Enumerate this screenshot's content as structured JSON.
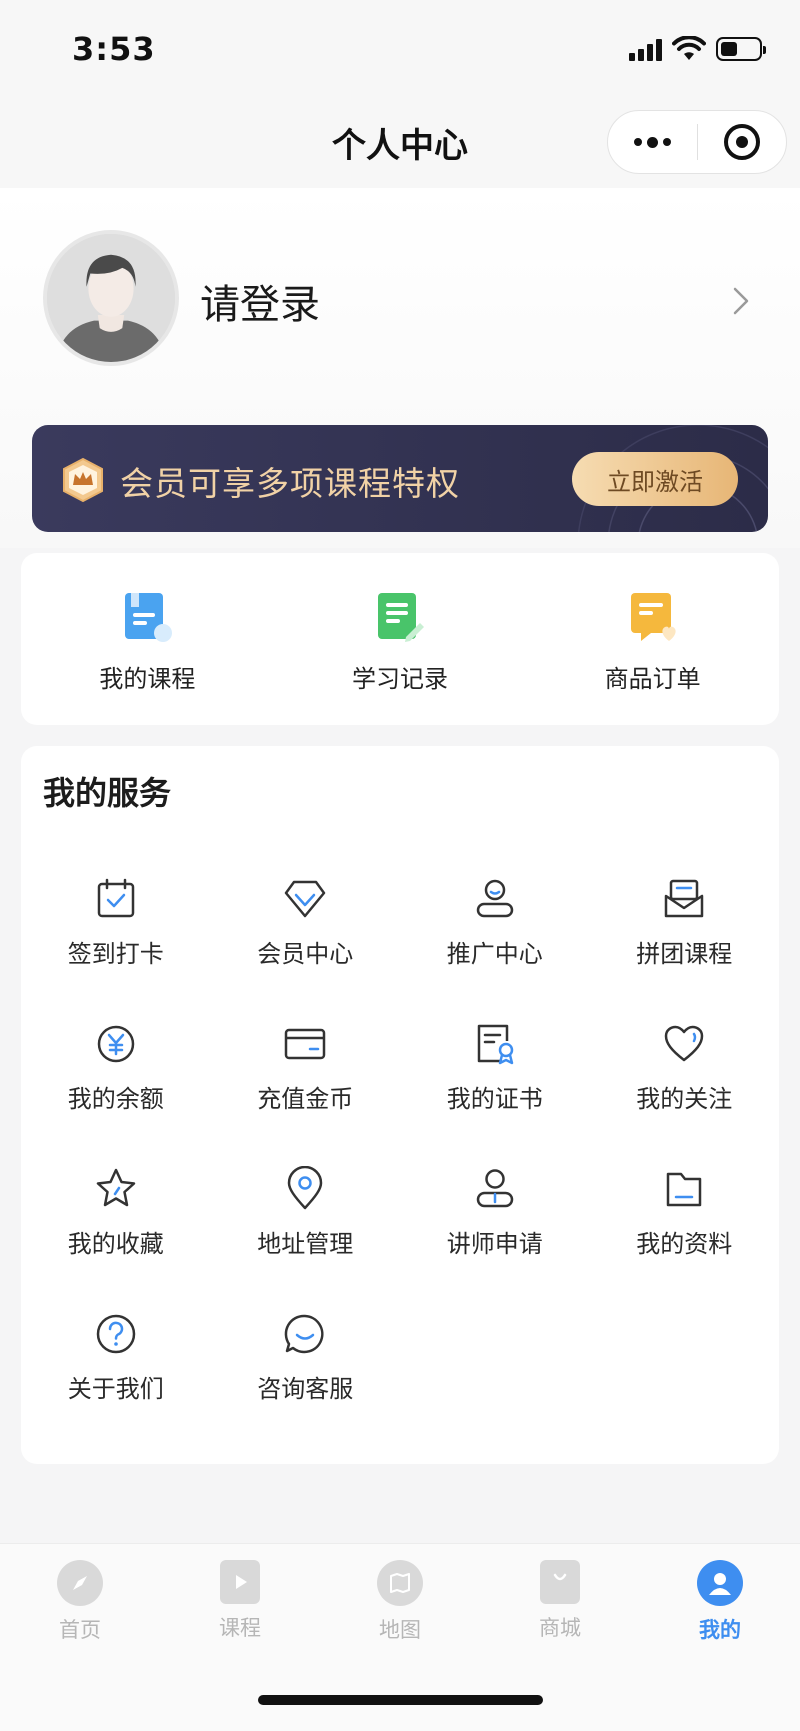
{
  "status_bar": {
    "time": "3:53"
  },
  "nav": {
    "title": "个人中心"
  },
  "profile": {
    "login_prompt": "请登录"
  },
  "vip_banner": {
    "text": "会员可享多项课程特权",
    "button": "立即激活"
  },
  "quick_links": [
    {
      "label": "我的课程",
      "icon": "course-book-icon",
      "color": "#4aa3f0"
    },
    {
      "label": "学习记录",
      "icon": "study-record-icon",
      "color": "#49c46a"
    },
    {
      "label": "商品订单",
      "icon": "order-icon",
      "color": "#f5b83d"
    }
  ],
  "services": {
    "title": "我的服务",
    "items": [
      {
        "label": "签到打卡",
        "icon": "checkin-calendar-icon"
      },
      {
        "label": "会员中心",
        "icon": "diamond-icon"
      },
      {
        "label": "推广中心",
        "icon": "promoter-user-icon"
      },
      {
        "label": "拼团课程",
        "icon": "group-envelope-icon"
      },
      {
        "label": "我的余额",
        "icon": "yen-coin-icon"
      },
      {
        "label": "充值金币",
        "icon": "card-icon"
      },
      {
        "label": "我的证书",
        "icon": "certificate-icon"
      },
      {
        "label": "我的关注",
        "icon": "heart-icon"
      },
      {
        "label": "我的收藏",
        "icon": "star-icon"
      },
      {
        "label": "地址管理",
        "icon": "location-pin-icon"
      },
      {
        "label": "讲师申请",
        "icon": "lecturer-icon"
      },
      {
        "label": "我的资料",
        "icon": "folder-icon"
      },
      {
        "label": "关于我们",
        "icon": "question-icon"
      },
      {
        "label": "咨询客服",
        "icon": "chat-icon"
      }
    ]
  },
  "tab_bar": {
    "items": [
      {
        "label": "首页",
        "icon": "compass-icon",
        "active": false
      },
      {
        "label": "课程",
        "icon": "course-play-icon",
        "active": false
      },
      {
        "label": "地图",
        "icon": "map-icon",
        "active": false
      },
      {
        "label": "商城",
        "icon": "shopping-bag-icon",
        "active": false
      },
      {
        "label": "我的",
        "icon": "user-icon",
        "active": true
      }
    ]
  },
  "colors": {
    "accent": "#3e8ef0",
    "vip_gold": "#f1d2a6",
    "vip_bg": "#34344f"
  }
}
